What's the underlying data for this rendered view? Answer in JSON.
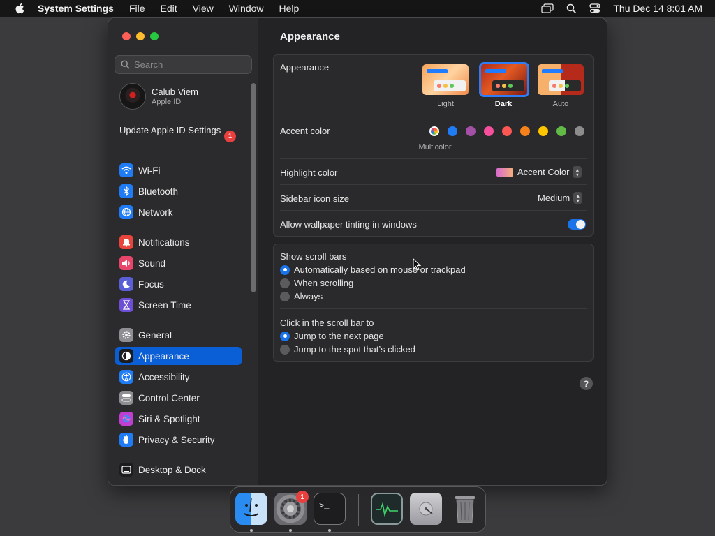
{
  "menubar": {
    "app_name": "System Settings",
    "items": [
      "File",
      "Edit",
      "View",
      "Window",
      "Help"
    ],
    "clock": "Thu Dec 14  8:01 AM"
  },
  "sidebar": {
    "search_placeholder": "Search",
    "account": {
      "name": "Calub Viem",
      "subtitle": "Apple ID"
    },
    "update": {
      "label": "Update Apple ID Settings",
      "badge": "1"
    },
    "items": [
      {
        "label": "Wi-Fi",
        "icon": "wifi-icon",
        "color": "#1f7cf5"
      },
      {
        "label": "Bluetooth",
        "icon": "bluetooth-icon",
        "color": "#1f7cf5"
      },
      {
        "label": "Network",
        "icon": "globe-icon",
        "color": "#1f7cf5"
      },
      {
        "label": "Notifications",
        "icon": "bell-icon",
        "color": "#e8453c"
      },
      {
        "label": "Sound",
        "icon": "speaker-icon",
        "color": "#e8456b"
      },
      {
        "label": "Focus",
        "icon": "moon-icon",
        "color": "#5b5fd6"
      },
      {
        "label": "Screen Time",
        "icon": "hourglass-icon",
        "color": "#6d4fd6"
      },
      {
        "label": "General",
        "icon": "gear-icon",
        "color": "#8e8e93"
      },
      {
        "label": "Appearance",
        "icon": "appearance-icon",
        "color": "#1c1c1e"
      },
      {
        "label": "Accessibility",
        "icon": "accessibility-icon",
        "color": "#1f7cf5"
      },
      {
        "label": "Control Center",
        "icon": "control-center-icon",
        "color": "#8e8e93"
      },
      {
        "label": "Siri & Spotlight",
        "icon": "siri-icon",
        "color": "#c03fd0"
      },
      {
        "label": "Privacy & Security",
        "icon": "hand-icon",
        "color": "#1f7cf5"
      },
      {
        "label": "Desktop & Dock",
        "icon": "dock-icon",
        "color": "#1c1c1e"
      }
    ]
  },
  "main": {
    "title": "Appearance",
    "appearance": {
      "label": "Appearance",
      "options": [
        "Light",
        "Dark",
        "Auto"
      ],
      "selected": "Dark"
    },
    "accent": {
      "label": "Accent color",
      "caption": "Multicolor",
      "colors": [
        "#1f7cf5",
        "#a550a7",
        "#f74f9e",
        "#fc5753",
        "#f7821b",
        "#ffc600",
        "#62ba46",
        "#8c8c8c"
      ]
    },
    "highlight": {
      "label": "Highlight color",
      "value": "Accent Color"
    },
    "sidebar_icon_size": {
      "label": "Sidebar icon size",
      "value": "Medium"
    },
    "wallpaper_tinting": {
      "label": "Allow wallpaper tinting in windows",
      "on": true
    },
    "scroll_bars": {
      "label": "Show scroll bars",
      "options": [
        "Automatically based on mouse or trackpad",
        "When scrolling",
        "Always"
      ],
      "selected": 0
    },
    "click_scroll": {
      "label": "Click in the scroll bar to",
      "options": [
        "Jump to the next page",
        "Jump to the spot that’s clicked"
      ],
      "selected": 0
    },
    "help": "?"
  },
  "dock": {
    "apps": [
      "finder-icon",
      "system-settings-icon",
      "terminal-icon",
      "activity-monitor-icon",
      "disk-utility-icon",
      "trash-icon"
    ],
    "settings_badge": "1"
  }
}
